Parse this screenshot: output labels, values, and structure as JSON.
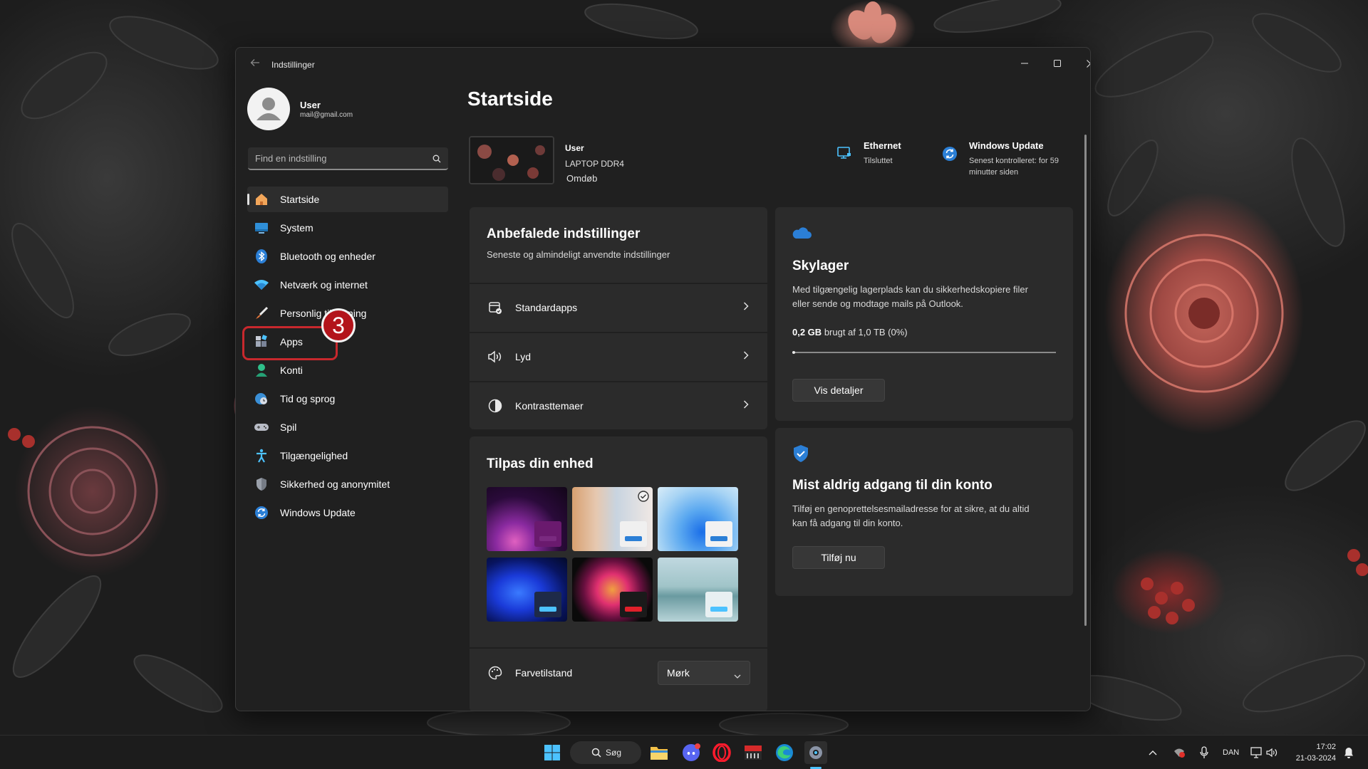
{
  "window": {
    "title": "Indstillinger"
  },
  "profile": {
    "name": "User",
    "email": "mail@gmail.com"
  },
  "search": {
    "placeholder": "Find en indstilling"
  },
  "nav": {
    "items": [
      {
        "label": "Startside",
        "icon": "home-icon"
      },
      {
        "label": "System",
        "icon": "system-icon"
      },
      {
        "label": "Bluetooth og enheder",
        "icon": "bluetooth-icon"
      },
      {
        "label": "Netværk og internet",
        "icon": "wifi-icon"
      },
      {
        "label": "Personlig tilpasning",
        "icon": "brush-icon"
      },
      {
        "label": "Apps",
        "icon": "apps-icon"
      },
      {
        "label": "Konti",
        "icon": "account-icon"
      },
      {
        "label": "Tid og sprog",
        "icon": "globe-clock-icon"
      },
      {
        "label": "Spil",
        "icon": "gamepad-icon"
      },
      {
        "label": "Tilgængelighed",
        "icon": "accessibility-icon"
      },
      {
        "label": "Sikkerhed og anonymitet",
        "icon": "shield-icon"
      },
      {
        "label": "Windows Update",
        "icon": "update-icon"
      }
    ]
  },
  "annotation": {
    "number": "3"
  },
  "main": {
    "title": "Startside",
    "device": {
      "user": "User",
      "model": "LAPTOP DDR4",
      "rename": "Omdøb"
    },
    "ethernet": {
      "title": "Ethernet",
      "status": "Tilsluttet"
    },
    "windows_update": {
      "title": "Windows Update",
      "status_line1": "Senest kontrolleret: for 59",
      "status_line2": "minutter siden"
    },
    "recommended": {
      "title": "Anbefalede indstillinger",
      "subtitle": "Seneste og almindeligt anvendte indstillinger",
      "items": [
        {
          "label": "Standardapps",
          "icon": "default-apps-icon"
        },
        {
          "label": "Lyd",
          "icon": "speaker-icon"
        },
        {
          "label": "Kontrasttemaer",
          "icon": "contrast-icon"
        }
      ]
    },
    "customize": {
      "title": "Tilpas din enhed",
      "color_mode_label": "Farvetilstand",
      "color_mode_value": "Mørk"
    },
    "cloud": {
      "title": "Skylager",
      "desc_line1": "Med tilgængelig lagerplads kan du sikkerhedskopiere filer",
      "desc_line2": "eller sende og modtage mails på Outlook.",
      "used": "0,2 GB",
      "usage_text": "brugt af 1,0 TB (0%)",
      "usage_fraction": 0.002,
      "button": "Vis detaljer"
    },
    "account": {
      "title": "Mist aldrig adgang til din konto",
      "desc_line1": "Tilføj en genoprettelsesmailadresse for at sikre, at du altid",
      "desc_line2": "kan få adgang til din konto.",
      "button": "Tilføj nu"
    }
  },
  "taskbar": {
    "search_label": "Søg",
    "language": "DAN",
    "time": "17:02",
    "date": "21-03-2024"
  },
  "colors": {
    "accent": "#4cc2ff",
    "annotation_red": "#c8282d",
    "window_bg": "#202020",
    "card_bg": "#2b2b2b"
  }
}
